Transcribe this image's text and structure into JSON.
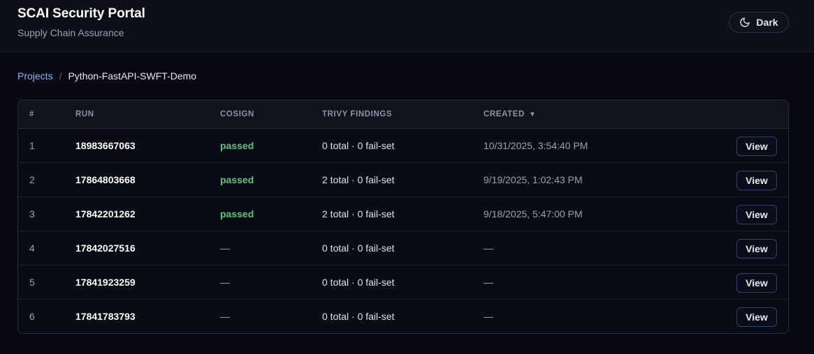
{
  "header": {
    "title": "SCAI Security Portal",
    "subtitle": "Supply Chain Assurance",
    "theme_toggle": {
      "label": "Dark",
      "icon": "moon-icon"
    }
  },
  "breadcrumb": {
    "parent": "Projects",
    "separator": "/",
    "current": "Python-FastAPI-SWFT-Demo"
  },
  "table": {
    "columns": {
      "index": "#",
      "run": "RUN",
      "cosign": "COSIGN",
      "trivy": "TRIVY FINDINGS",
      "created": "CREATED",
      "created_sort": "▼"
    },
    "rows": [
      {
        "index": "1",
        "run": "18983667063",
        "cosign": "passed",
        "trivy": "0 total · 0 fail-set",
        "created": "10/31/2025, 3:54:40 PM",
        "action": "View"
      },
      {
        "index": "2",
        "run": "17864803668",
        "cosign": "passed",
        "trivy": "2 total · 0 fail-set",
        "created": "9/19/2025, 1:02:43 PM",
        "action": "View"
      },
      {
        "index": "3",
        "run": "17842201262",
        "cosign": "passed",
        "trivy": "2 total · 0 fail-set",
        "created": "9/18/2025, 5:47:00 PM",
        "action": "View"
      },
      {
        "index": "4",
        "run": "17842027516",
        "cosign": "—",
        "trivy": "0 total · 0 fail-set",
        "created": "—",
        "action": "View"
      },
      {
        "index": "5",
        "run": "17841923259",
        "cosign": "—",
        "trivy": "0 total · 0 fail-set",
        "created": "—",
        "action": "View"
      },
      {
        "index": "6",
        "run": "17841783793",
        "cosign": "—",
        "trivy": "0 total · 0 fail-set",
        "created": "—",
        "action": "View"
      }
    ]
  },
  "colors": {
    "background": "#080911",
    "link": "#8fb2ff",
    "passed": "#5cc47d",
    "button_border": "#34406a"
  }
}
